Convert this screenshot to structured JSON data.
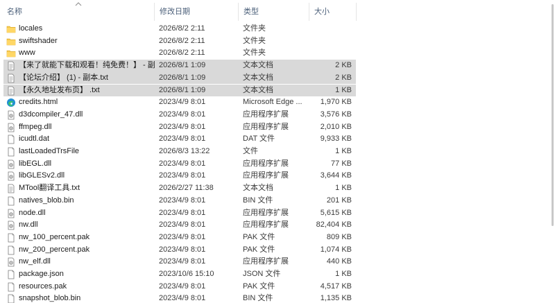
{
  "columns": {
    "name": "名称",
    "date": "修改日期",
    "type": "类型",
    "size": "大小"
  },
  "files": [
    {
      "name": "locales",
      "date": "2026/8/2 2:11",
      "type": "文件夹",
      "size": "",
      "icon": "folder-icon"
    },
    {
      "name": "swiftshader",
      "date": "2026/8/2 2:11",
      "type": "文件夹",
      "size": "",
      "icon": "folder-icon"
    },
    {
      "name": "www",
      "date": "2026/8/2 2:11",
      "type": "文件夹",
      "size": "",
      "icon": "folder-icon"
    },
    {
      "name": "【来了就能下载和观看！纯免费！】 - 副...",
      "date": "2026/8/1 1:09",
      "type": "文本文档",
      "size": "2 KB",
      "icon": "text-file-icon",
      "selected": true
    },
    {
      "name": "【论坛介绍】 (1) - 副本.txt",
      "date": "2026/8/1 1:09",
      "type": "文本文档",
      "size": "2 KB",
      "icon": "text-file-icon",
      "selected": true
    },
    {
      "name": "【永久地址发布页】 .txt",
      "date": "2026/8/1 1:09",
      "type": "文本文档",
      "size": "1 KB",
      "icon": "text-file-icon",
      "selected": true
    },
    {
      "name": "credits.html",
      "date": "2023/4/9 8:01",
      "type": "Microsoft Edge ...",
      "size": "1,970 KB",
      "icon": "edge-icon"
    },
    {
      "name": "d3dcompiler_47.dll",
      "date": "2023/4/9 8:01",
      "type": "应用程序扩展",
      "size": "3,576 KB",
      "icon": "dll-file-icon"
    },
    {
      "name": "ffmpeg.dll",
      "date": "2023/4/9 8:01",
      "type": "应用程序扩展",
      "size": "2,010 KB",
      "icon": "dll-file-icon"
    },
    {
      "name": "icudtl.dat",
      "date": "2023/4/9 8:01",
      "type": "DAT 文件",
      "size": "9,933 KB",
      "icon": "blank-file-icon"
    },
    {
      "name": "lastLoadedTrsFile",
      "date": "2026/8/3 13:22",
      "type": "文件",
      "size": "1 KB",
      "icon": "blank-file-icon"
    },
    {
      "name": "libEGL.dll",
      "date": "2023/4/9 8:01",
      "type": "应用程序扩展",
      "size": "77 KB",
      "icon": "dll-file-icon"
    },
    {
      "name": "libGLESv2.dll",
      "date": "2023/4/9 8:01",
      "type": "应用程序扩展",
      "size": "3,644 KB",
      "icon": "dll-file-icon"
    },
    {
      "name": "MTool翻译工具.txt",
      "date": "2026/2/27 11:38",
      "type": "文本文档",
      "size": "1 KB",
      "icon": "text-file-icon"
    },
    {
      "name": "natives_blob.bin",
      "date": "2023/4/9 8:01",
      "type": "BIN 文件",
      "size": "201 KB",
      "icon": "blank-file-icon"
    },
    {
      "name": "node.dll",
      "date": "2023/4/9 8:01",
      "type": "应用程序扩展",
      "size": "5,615 KB",
      "icon": "dll-file-icon"
    },
    {
      "name": "nw.dll",
      "date": "2023/4/9 8:01",
      "type": "应用程序扩展",
      "size": "82,404 KB",
      "icon": "dll-file-icon"
    },
    {
      "name": "nw_100_percent.pak",
      "date": "2023/4/9 8:01",
      "type": "PAK 文件",
      "size": "809 KB",
      "icon": "blank-file-icon"
    },
    {
      "name": "nw_200_percent.pak",
      "date": "2023/4/9 8:01",
      "type": "PAK 文件",
      "size": "1,074 KB",
      "icon": "blank-file-icon"
    },
    {
      "name": "nw_elf.dll",
      "date": "2023/4/9 8:01",
      "type": "应用程序扩展",
      "size": "440 KB",
      "icon": "dll-file-icon"
    },
    {
      "name": "package.json",
      "date": "2023/10/6 15:10",
      "type": "JSON 文件",
      "size": "1 KB",
      "icon": "blank-file-icon"
    },
    {
      "name": "resources.pak",
      "date": "2023/4/9 8:01",
      "type": "PAK 文件",
      "size": "4,517 KB",
      "icon": "blank-file-icon"
    },
    {
      "name": "snapshot_blob.bin",
      "date": "2023/4/9 8:01",
      "type": "BIN 文件",
      "size": "1,135 KB",
      "icon": "blank-file-icon"
    }
  ],
  "colors": {
    "folder": "#f4c74c",
    "selection": "#d9d9d9",
    "header_text": "#4c607a",
    "edge": "#1f8fd6"
  }
}
